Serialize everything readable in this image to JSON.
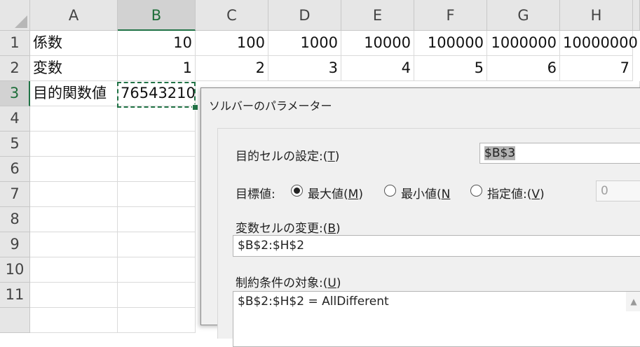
{
  "columns": [
    "A",
    "B",
    "C",
    "D",
    "E",
    "F",
    "G",
    "H"
  ],
  "rows": [
    "1",
    "2",
    "3",
    "4",
    "5",
    "6",
    "7",
    "8",
    "9",
    "10",
    "11"
  ],
  "row1": [
    "係数",
    "10",
    "100",
    "1000",
    "10000",
    "100000",
    "1000000",
    "10000000"
  ],
  "row2": [
    "変数",
    "1",
    "2",
    "3",
    "4",
    "5",
    "6",
    "7"
  ],
  "row3": [
    "目的関数値",
    "76543210"
  ],
  "dialog": {
    "title": "ソルバーのパラメーター",
    "objective_label_pre": "目的セルの設定:(",
    "objective_label_key": "T",
    "objective_label_post": ")",
    "objective_value": "$B$3",
    "target_label": "目標値:",
    "max_label_pre": "最大値(",
    "max_label_key": "M",
    "max_label_post": ")",
    "min_label_pre": "最小値(",
    "min_label_key": "N",
    "value_label_pre": "指定値:(",
    "value_label_key": "V",
    "value_label_post": ")",
    "value_input": "0",
    "selected_target": "max",
    "variable_label_pre": "変数セルの変更:(",
    "variable_label_key": "B",
    "variable_label_post": ")",
    "variable_value": "$B$2:$H$2",
    "constraint_label_pre": "制約条件の対象:(",
    "constraint_label_key": "U",
    "constraint_label_post": ")",
    "constraint_item": "$B$2:$H$2 = AllDifferent"
  },
  "colors": {
    "accent": "#217346",
    "header_bg": "#e6e6e6",
    "dialog_bg": "#f0f0f0"
  }
}
